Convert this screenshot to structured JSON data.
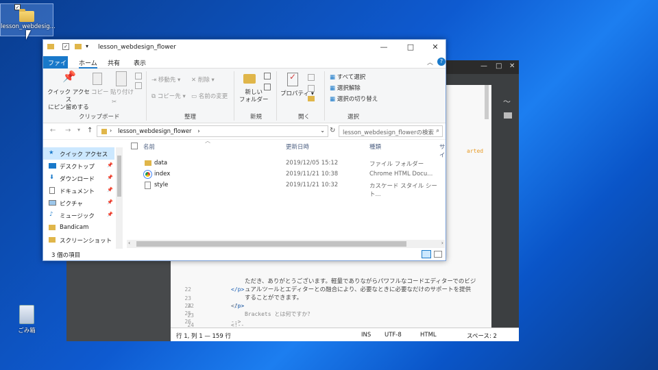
{
  "desktop": {
    "folder_label": "lesson_webdesig...",
    "recycle_label": "ごみ箱"
  },
  "brackets": {
    "gutter": [
      "22",
      "23",
      "24",
      "25",
      "26"
    ],
    "lines": [
      "</p>",
      "",
      "<!--",
      "Brackets とは何ですか？",
      "-->"
    ],
    "partial_text": [
      "ただき、ありがとうございます。軽量でありながらパワフルなコードエディターでのビジ",
      "ュアルツールとエディターとの融合により、必要なときに必要なだけのサポートを提供",
      "することができます。"
    ],
    "code_orange": "arted",
    "status": {
      "position": "行 1, 列 1 — 159 行",
      "ins": "INS",
      "encoding": "UTF-8",
      "language": "HTML",
      "spaces": "スペース: 2"
    }
  },
  "explorer": {
    "title": "lesson_webdesign_flower",
    "tabs": {
      "file": "ファイル",
      "home": "ホーム",
      "share": "共有",
      "view": "表示"
    },
    "ribbon": {
      "pin": "クイック アクセス\nにピン留めする",
      "copy": "コピー",
      "paste": "貼り付け",
      "group_clipboard": "クリップボード",
      "move_to": "移動先",
      "copy_to": "コピー先",
      "delete": "削除",
      "rename": "名前の変更",
      "group_organize": "整理",
      "new_folder": "新しい\nフォルダー",
      "group_new": "新規",
      "properties": "プロパティ",
      "group_open": "開く",
      "select_all": "すべて選択",
      "select_none": "選択解除",
      "invert": "選択の切り替え",
      "group_select": "選択"
    },
    "address": "lesson_webdesign_flower",
    "search_placeholder": "lesson_webdesign_flowerの検索",
    "nav_items": [
      "クイック アクセス",
      "デスクトップ",
      "ダウンロード",
      "ドキュメント",
      "ピクチャ",
      "ミュージック",
      "Bandicam",
      "スクリーンショット"
    ],
    "columns": {
      "name": "名前",
      "date": "更新日時",
      "type": "種類",
      "size": "サイ"
    },
    "files": [
      {
        "name": "data",
        "date": "2019/12/05 15:12",
        "type": "ファイル フォルダー",
        "icon": "folder-icon"
      },
      {
        "name": "index",
        "date": "2019/11/21 10:38",
        "type": "Chrome HTML Docu...",
        "icon": "chrome-icon"
      },
      {
        "name": "style",
        "date": "2019/11/21 10:32",
        "type": "カスケード スタイル シート...",
        "icon": "css-file-icon"
      }
    ],
    "status": "3 個の項目"
  },
  "colors": {
    "accent": "#1979ca",
    "selection": "#cce8ff"
  }
}
